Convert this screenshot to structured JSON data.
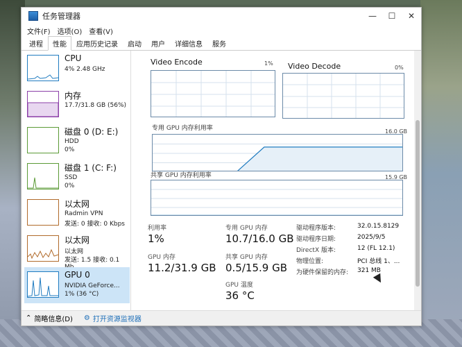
{
  "window": {
    "title": "任务管理器",
    "controls": {
      "minimize": "—",
      "maximize": "☐",
      "close": "✕"
    }
  },
  "menu": [
    "文件(F)",
    "选项(O)",
    "查看(V)"
  ],
  "tabs": [
    "进程",
    "性能",
    "应用历史记录",
    "启动",
    "用户",
    "详细信息",
    "服务"
  ],
  "sidebar": {
    "items": [
      {
        "name": "CPU",
        "sub": "4% 2.48 GHz",
        "sub2": ""
      },
      {
        "name": "内存",
        "sub": "17.7/31.8 GB (56%)",
        "sub2": ""
      },
      {
        "name": "磁盘 0 (D: E:)",
        "sub": "HDD",
        "sub2": "0%"
      },
      {
        "name": "磁盘 1 (C: F:)",
        "sub": "SSD",
        "sub2": "0%"
      },
      {
        "name": "以太网",
        "sub": "Radmin VPN",
        "sub2": "发送: 0 接收: 0 Kbps"
      },
      {
        "name": "以太网",
        "sub": "以太网",
        "sub2": "发送: 1.5 接收: 0.1 Mb"
      },
      {
        "name": "GPU 0",
        "sub": "NVIDIA GeForce...",
        "sub2": "1% (36 °C)"
      }
    ]
  },
  "main": {
    "video_encode": {
      "label": "Video Encode",
      "pct": "1%"
    },
    "video_decode": {
      "label": "Video Decode",
      "pct": "0%"
    },
    "dedicated_chart": {
      "label": "专用 GPU 内存利用率",
      "max": "16.0 GB"
    },
    "shared_chart": {
      "label": "共享 GPU 内存利用率",
      "max": "15.9 GB"
    },
    "stats": {
      "util_label": "利用率",
      "util_value": "1%",
      "dedicated_label": "专用 GPU 内存",
      "dedicated_value": "10.7/16.0 GB",
      "gpu_mem_label": "GPU 内存",
      "gpu_mem_value": "11.2/31.9 GB",
      "shared_label": "共享 GPU 内存",
      "shared_value": "0.5/15.9 GB",
      "temp_label": "GPU 温度",
      "temp_value": "36 °C"
    },
    "details": [
      {
        "label": "驱动程序版本:",
        "value": "32.0.15.8129"
      },
      {
        "label": "驱动程序日期:",
        "value": "2025/9/5"
      },
      {
        "label": "DirectX 版本:",
        "value": "12 (FL 12.1)"
      },
      {
        "label": "物理位置:",
        "value": "PCI 总线 1、..."
      },
      {
        "label": "为硬件保留的内存:",
        "value": "321 MB"
      }
    ]
  },
  "footer": {
    "summary": "简略信息(D)",
    "monitor": "打开资源监视器"
  },
  "chart_data": {
    "type": "line",
    "title": "",
    "series": [
      {
        "name": "专用 GPU 内存利用率",
        "values": [
          0,
          0,
          0,
          0,
          10.7,
          10.7,
          10.7,
          10.7,
          10.7,
          10.7
        ]
      },
      {
        "name": "共享 GPU 内存利用率",
        "values": [
          0.5,
          0.5,
          0.5,
          0.5,
          0.5,
          0.5,
          0.5,
          0.5,
          0.5,
          0.5
        ]
      }
    ]
  }
}
